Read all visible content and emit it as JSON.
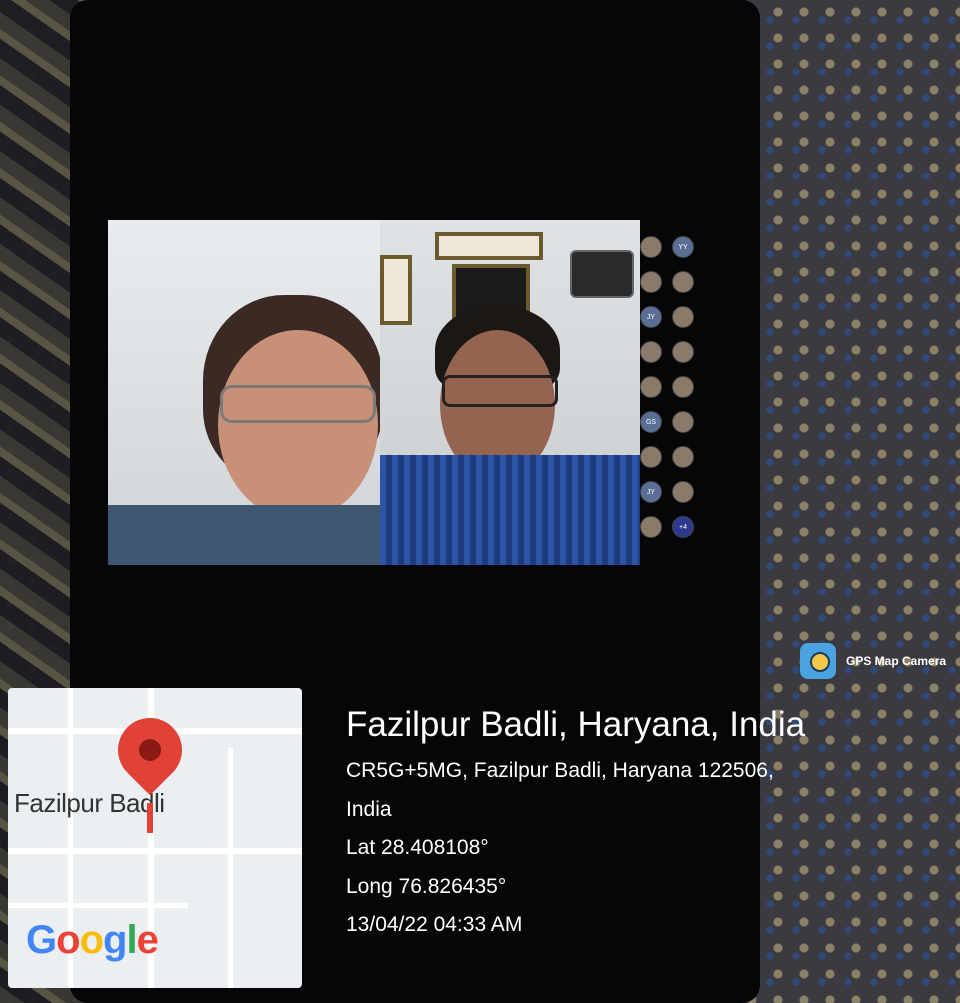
{
  "meeting": {
    "participants": [
      {
        "label": ""
      },
      {
        "label": "YY"
      },
      {
        "label": ""
      },
      {
        "label": ""
      },
      {
        "label": "JY"
      },
      {
        "label": ""
      },
      {
        "label": ""
      },
      {
        "label": ""
      },
      {
        "label": ""
      },
      {
        "label": ""
      },
      {
        "label": "GS"
      },
      {
        "label": ""
      },
      {
        "label": ""
      },
      {
        "label": ""
      },
      {
        "label": "JY"
      },
      {
        "label": ""
      },
      {
        "label": ""
      },
      {
        "label": "+4"
      }
    ]
  },
  "overlay": {
    "app_name": "GPS Map Camera",
    "place_title": "Fazilpur Badli, Haryana, India",
    "address_line": "CR5G+5MG, Fazilpur Badli, Haryana 122506,",
    "country_line": "India",
    "lat": "Lat 28.408108°",
    "long": "Long 76.826435°",
    "timestamp": "13/04/22 04:33 AM"
  },
  "map": {
    "area_label": "Fazilpur Badli",
    "brand": {
      "g1": "G",
      "o1": "o",
      "o2": "o",
      "g2": "g",
      "l": "l",
      "e": "e"
    }
  },
  "colors": {
    "pin": "#e04238",
    "participant_more": "#2d3a8c",
    "google_blue": "#4285f4",
    "google_red": "#ea4335",
    "google_yellow": "#fbbc05",
    "google_green": "#34a853"
  }
}
